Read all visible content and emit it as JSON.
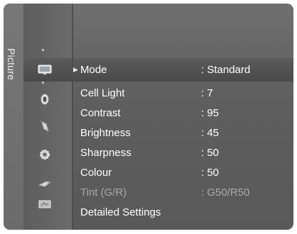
{
  "menu": {
    "category": "Picture",
    "items": [
      {
        "label": "Mode",
        "value": ": Standard"
      },
      {
        "label": "Cell Light",
        "value": ": 7"
      },
      {
        "label": "Contrast",
        "value": ": 95"
      },
      {
        "label": "Brightness",
        "value": ": 45"
      },
      {
        "label": "Sharpness",
        "value": ": 50"
      },
      {
        "label": "Colour",
        "value": ": 50"
      },
      {
        "label": "Tint (G/R)",
        "value": ": G50/R50"
      },
      {
        "label": "Detailed Settings",
        "value": ""
      }
    ]
  },
  "icons": [
    "picture-icon",
    "sound-icon",
    "channel-icon",
    "setup-icon",
    "input-icon",
    "application-icon"
  ],
  "colors": {
    "background": "#636363",
    "text": "#ffffff",
    "disabled_text": "#a9a9a9"
  }
}
